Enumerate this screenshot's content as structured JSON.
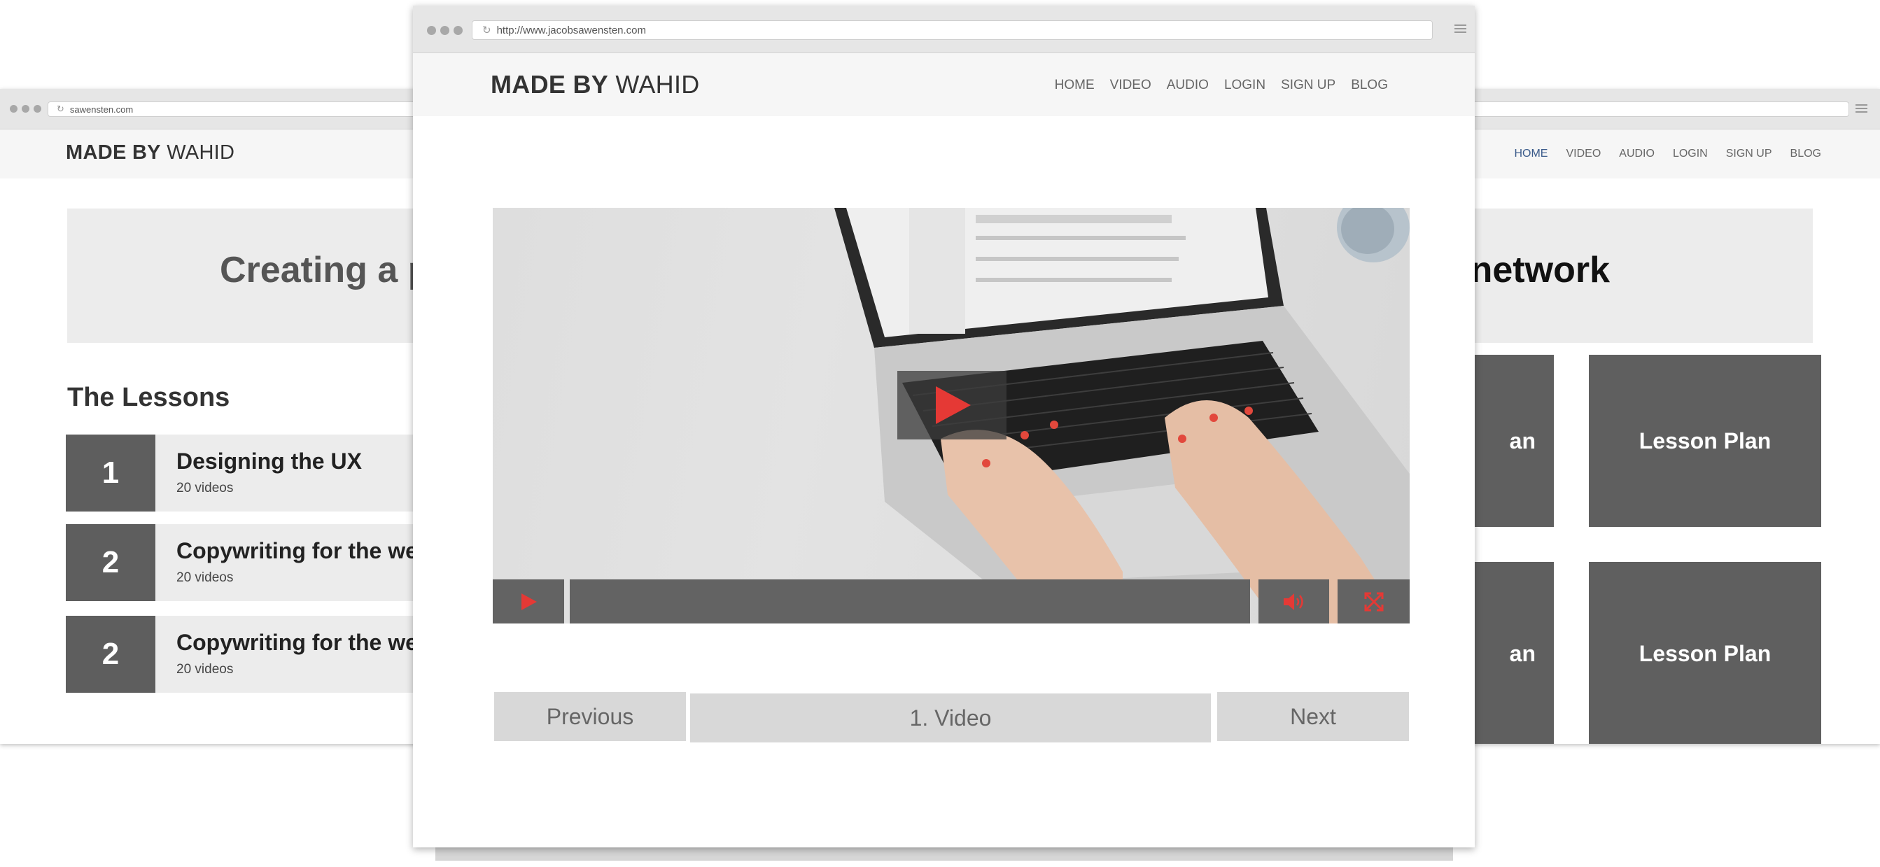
{
  "back_window": {
    "url": "sawensten.com",
    "logo_bold": "MADE BY",
    "logo_light": "WAHID",
    "nav": [
      "HOME",
      "VIDEO",
      "AUDIO",
      "LOGIN",
      "SIGN UP",
      "BLOG"
    ],
    "hero_left": "Creating a p",
    "hero_right": "ast network",
    "lessons_heading": "The Lessons",
    "lessons": [
      {
        "number": "1",
        "title": "Designing the UX",
        "subtitle": "20 videos"
      },
      {
        "number": "2",
        "title": "Copywriting for the we",
        "subtitle": "20 videos"
      },
      {
        "number": "2",
        "title": "Copywriting for the we",
        "subtitle": "20 videos"
      }
    ],
    "plans": [
      "an",
      "Lesson Plan",
      "an",
      "Lesson Plan"
    ]
  },
  "front_window": {
    "url": "http://www.jacobsawensten.com",
    "logo_bold": "MADE BY",
    "logo_light": "WAHID",
    "nav": [
      "HOME",
      "VIDEO",
      "AUDIO",
      "LOGIN",
      "SIGN UP",
      "BLOG"
    ],
    "video": {
      "controls": [
        "play-icon",
        "progress-bar",
        "volume-icon",
        "fullscreen-icon"
      ],
      "accent_color": "#e53935"
    },
    "pager": {
      "previous": "Previous",
      "current": "1. Video",
      "next": "Next"
    }
  }
}
